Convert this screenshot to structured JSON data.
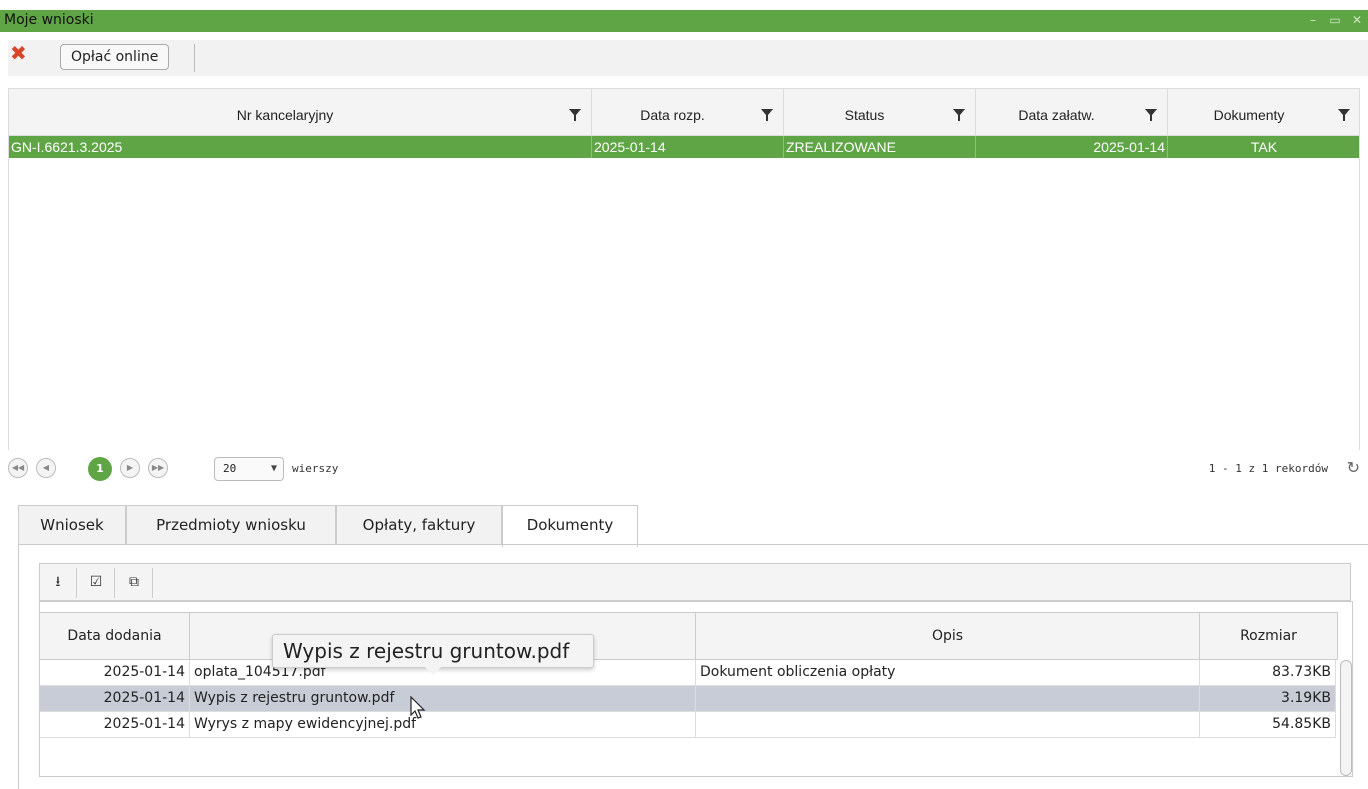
{
  "window": {
    "title": "Moje wnioski"
  },
  "toolbar": {
    "pay_label": "Opłać online"
  },
  "grid": {
    "columns": [
      "Nr kancelaryjny",
      "Data rozp.",
      "Status",
      "Data załatw.",
      "Dokumenty"
    ],
    "rows": [
      {
        "nr": "GN-I.6621.3.2025",
        "data_rozp": "2025-01-14",
        "status": "ZREALIZOWANE",
        "data_zalatw": "2025-01-14",
        "dokumenty": "TAK"
      }
    ]
  },
  "pager": {
    "current_page": "1",
    "rows_per_page": "20",
    "rows_label": "wierszy",
    "records_text": "1 - 1 z 1 rekordów"
  },
  "tabs": [
    "Wniosek",
    "Przedmioty wniosku",
    "Opłaty, faktury",
    "Dokumenty"
  ],
  "active_tab": "Dokumenty",
  "documents": {
    "columns": {
      "date": "Data dodania",
      "name": "",
      "desc": "Opis",
      "size": "Rozmiar"
    },
    "rows": [
      {
        "date": "2025-01-14",
        "name": "oplata_104517.pdf",
        "desc": "Dokument obliczenia opłaty",
        "size": "83.73KB"
      },
      {
        "date": "2025-01-14",
        "name": "Wypis z rejestru gruntow.pdf",
        "desc": "",
        "size": "3.19KB"
      },
      {
        "date": "2025-01-14",
        "name": "Wyrys z mapy ewidencyjnej.pdf",
        "desc": "",
        "size": "54.85KB"
      }
    ]
  },
  "tooltip": {
    "text": "Wypis z rejestru gruntow.pdf"
  },
  "colors": {
    "accent": "#5fa546",
    "selected_row": "#c8ccd6",
    "close": "#d8452b"
  }
}
